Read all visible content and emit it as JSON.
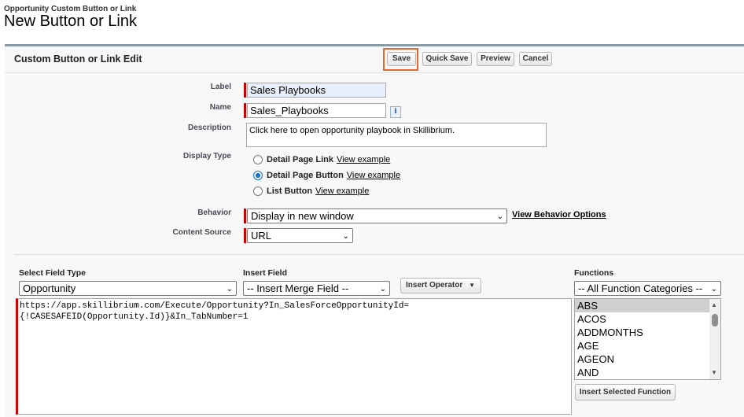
{
  "header": {
    "breadcrumb": "Opportunity Custom Button or Link",
    "title": "New Button or Link"
  },
  "panel": {
    "title": "Custom Button or Link Edit",
    "buttons": {
      "save": "Save",
      "quick_save": "Quick Save",
      "preview": "Preview",
      "cancel": "Cancel"
    }
  },
  "form": {
    "label": {
      "label": "Label",
      "value": "Sales Playbooks"
    },
    "name": {
      "label": "Name",
      "value": "Sales_Playbooks",
      "info_icon": "i"
    },
    "description": {
      "label": "Description",
      "value": "Click here to open opportunity playbook in Skillibrium."
    },
    "display_type": {
      "label": "Display Type",
      "options": [
        {
          "label": "Detail Page Link",
          "link": "View example",
          "checked": false
        },
        {
          "label": "Detail Page Button",
          "link": "View example",
          "checked": true
        },
        {
          "label": "List Button",
          "link": "View example",
          "checked": false
        }
      ]
    },
    "behavior": {
      "label": "Behavior",
      "value": "Display in new window",
      "link": "View Behavior Options"
    },
    "content_source": {
      "label": "Content Source",
      "value": "URL"
    }
  },
  "formula": {
    "select_field_type": {
      "label": "Select Field Type",
      "value": "Opportunity"
    },
    "insert_field": {
      "label": "Insert Field",
      "value": "-- Insert Merge Field --"
    },
    "insert_operator": "Insert Operator",
    "functions": {
      "label": "Functions",
      "category": "-- All Function Categories --",
      "items": [
        "ABS",
        "ACOS",
        "ADDMONTHS",
        "AGE",
        "AGEON",
        "AND"
      ],
      "insert_button": "Insert Selected Function"
    },
    "line1": "https://app.skillibrium.com/Execute/Opportunity?In_SalesForceOpportunityId=",
    "line2": "{!CASESAFEID(Opportunity.Id)}&In_TabNumber=1"
  },
  "colors": {
    "accent_highlight": "#e8692d",
    "required_bar": "#cc0000",
    "radio_selected": "#0b6fd6"
  }
}
